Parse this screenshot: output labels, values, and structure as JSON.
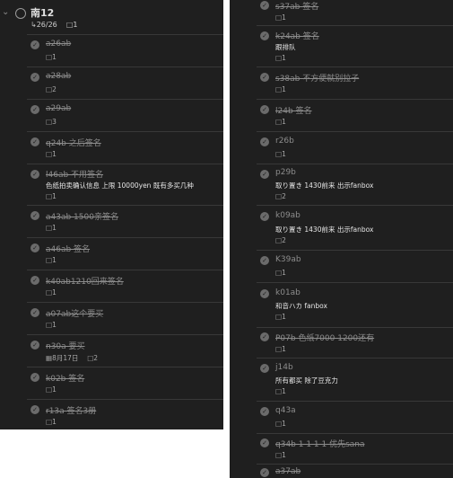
{
  "left": {
    "header": {
      "title": "南12",
      "subtask_count": "26/26",
      "comment_count": "1"
    },
    "tasks": [
      {
        "title": "a26ab",
        "comments": "1"
      },
      {
        "title": "a28ab",
        "comments": "2"
      },
      {
        "title": "a29ab",
        "comments": "3"
      },
      {
        "title": "q24b 之后签名",
        "comments": "1"
      },
      {
        "title": "l46ab 不用签名",
        "description": "色纸拍卖确认信息 上限 10000yen 既有多买几种",
        "comments": "1"
      },
      {
        "title": "a43ab 1500亲签名",
        "comments": "1"
      },
      {
        "title": "a46ab 签名",
        "comments": "1"
      },
      {
        "title": "k40ab1210回来签名",
        "comments": "1"
      },
      {
        "title": "a07ab这个要买",
        "comments": "1"
      },
      {
        "title": "n30a 要买",
        "date": "8月17日",
        "comments": "2"
      },
      {
        "title": "k02b 签名",
        "comments": "1"
      },
      {
        "title": "r13a 签名3册",
        "comments": "1"
      }
    ]
  },
  "right": {
    "tasks": [
      {
        "title": "s37ab 签名",
        "comments": "1"
      },
      {
        "title": "k24ab 签名",
        "description": "跟排队",
        "comments": "1"
      },
      {
        "title": "s38ab 不方便就别拉子",
        "comments": "1"
      },
      {
        "title": "l24b 签名",
        "comments": "1"
      },
      {
        "title": "r26b",
        "comments": "1"
      },
      {
        "title": "p29b",
        "description": "取り置き 1430前来 出示fanbox",
        "comments": "2"
      },
      {
        "title": "k09ab",
        "description": "取り置き 1430前来 出示fanbox",
        "comments": "2"
      },
      {
        "title": "K39ab",
        "comments": "1"
      },
      {
        "title": "k01ab",
        "description": "和音ハカ fanbox",
        "comments": "1"
      },
      {
        "title": "P07b 色纸7000 1200还有",
        "comments": "1"
      },
      {
        "title": "j14b",
        "description": "所有都买 除了豆克力",
        "comments": "1"
      },
      {
        "title": "q43a",
        "comments": "1"
      },
      {
        "title": "q34b 1 1 1 1 优先sana",
        "comments": "1"
      },
      {
        "title": "a37ab",
        "comments": ""
      }
    ]
  },
  "icons": {
    "chevron": "chevron-down-icon",
    "check": "check-circle-icon",
    "comment": "comment-icon",
    "subtask": "subtask-icon",
    "calendar": "calendar-icon"
  },
  "colors": {
    "panel_bg": "#1f1f1f",
    "check_fill": "#6b6b6b",
    "completed_text": "#8c8c8c",
    "description_text": "#e6e6e6",
    "divider": "#383838"
  }
}
